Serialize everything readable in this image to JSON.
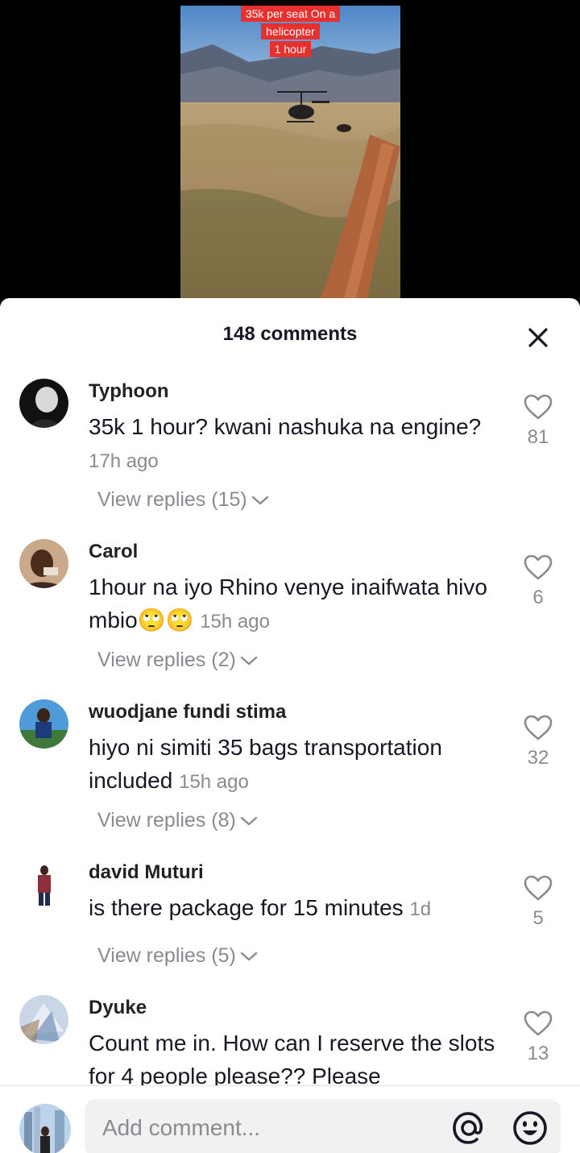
{
  "video": {
    "caption_lines": [
      "35k per seat On a",
      "helicopter",
      "1 hour"
    ]
  },
  "comments_sheet": {
    "title": "148 comments",
    "close_icon": "close-icon"
  },
  "comments": [
    {
      "username": "Typhoon",
      "text": "35k 1 hour? kwani nashuka na engine?",
      "time": "17h ago",
      "likes": "81",
      "replies_label": "View replies (15)"
    },
    {
      "username": "Carol",
      "text": "1hour na iyo Rhino venye inaifwata hivo mbio🙄🙄",
      "time": "15h ago",
      "likes": "6",
      "replies_label": "View replies (2)"
    },
    {
      "username": "wuodjane fundi stima",
      "text": "hiyo ni simiti 35 bags transportation included",
      "time": "15h ago",
      "likes": "32",
      "replies_label": "View replies (8)"
    },
    {
      "username": "david  Muturi",
      "text": "is there package for 15 minutes",
      "time": "1d",
      "likes": "5",
      "replies_label": "View replies (5)"
    },
    {
      "username": "Dyuke",
      "text": "Count me in. How can I reserve the slots for 4 people please?? Please",
      "time": "",
      "likes": "13",
      "replies_label": ""
    }
  ],
  "composer": {
    "placeholder": "Add comment...",
    "mention_icon": "at-icon",
    "emoji_icon": "emoji-icon"
  },
  "colors": {
    "caption_bg": "#e8302f",
    "muted_text": "#8a8b91",
    "primary_text": "#161823"
  }
}
